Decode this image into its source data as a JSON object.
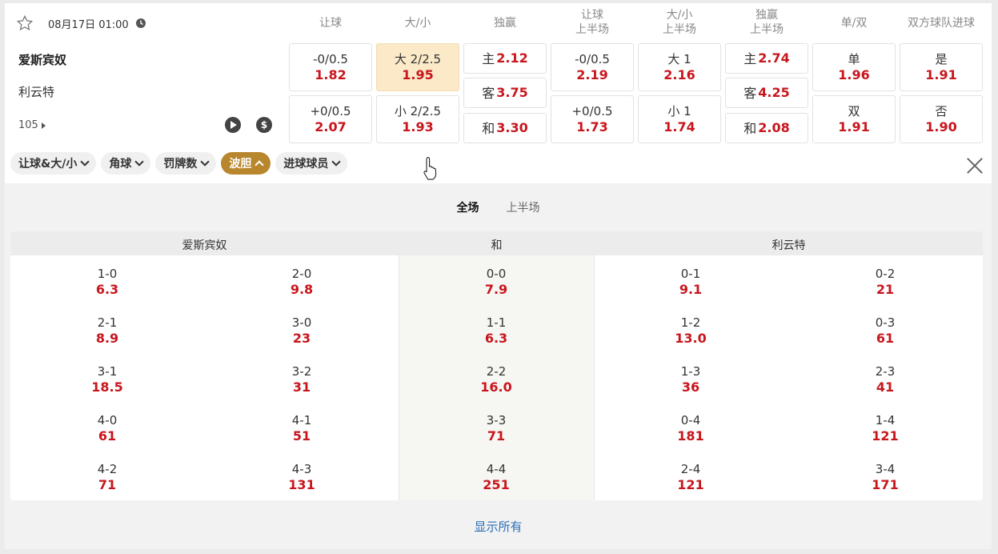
{
  "match": {
    "date": "08月17日 01:00",
    "home": "爱斯宾奴",
    "away": "利云特",
    "more_count": "105"
  },
  "columns": [
    {
      "line1": "让球",
      "line2": ""
    },
    {
      "line1": "大/小",
      "line2": ""
    },
    {
      "line1": "独赢",
      "line2": ""
    },
    {
      "line1": "让球",
      "line2": "上半场"
    },
    {
      "line1": "大/小",
      "line2": "上半场"
    },
    {
      "line1": "独赢",
      "line2": "上半场"
    },
    {
      "line1": "单/双",
      "line2": ""
    },
    {
      "line1": "双方球队进球",
      "line2": ""
    }
  ],
  "markets": {
    "ah_ft": [
      {
        "label": "-0/0.5",
        "odd": "1.82"
      },
      {
        "label": "+0/0.5",
        "odd": "2.07"
      }
    ],
    "ou_ft": [
      {
        "label": "大 2/2.5",
        "odd": "1.95"
      },
      {
        "label": "小 2/2.5",
        "odd": "1.93"
      }
    ],
    "x12_ft": [
      {
        "label": "主",
        "odd": "2.12"
      },
      {
        "label": "客",
        "odd": "3.75"
      },
      {
        "label": "和",
        "odd": "3.30"
      }
    ],
    "ah_ht": [
      {
        "label": "-0/0.5",
        "odd": "2.19"
      },
      {
        "label": "+0/0.5",
        "odd": "1.73"
      }
    ],
    "ou_ht": [
      {
        "label": "大 1",
        "odd": "2.16"
      },
      {
        "label": "小 1",
        "odd": "1.74"
      }
    ],
    "x12_ht": [
      {
        "label": "主",
        "odd": "2.74"
      },
      {
        "label": "客",
        "odd": "4.25"
      },
      {
        "label": "和",
        "odd": "2.08"
      }
    ],
    "oe": [
      {
        "label": "单",
        "odd": "1.96"
      },
      {
        "label": "双",
        "odd": "1.91"
      }
    ],
    "btts": [
      {
        "label": "是",
        "odd": "1.91"
      },
      {
        "label": "否",
        "odd": "1.90"
      }
    ]
  },
  "chips": [
    "让球&大/小",
    "角球",
    "罚牌数",
    "波胆",
    "进球球员"
  ],
  "period_tabs": [
    "全场",
    "上半场"
  ],
  "correct_score": {
    "headers": {
      "home": "爱斯宾奴",
      "draw": "和",
      "away": "利云特"
    },
    "home_a": [
      [
        "1-0",
        "6.3"
      ],
      [
        "2-1",
        "8.9"
      ],
      [
        "3-1",
        "18.5"
      ],
      [
        "4-0",
        "61"
      ],
      [
        "4-2",
        "71"
      ]
    ],
    "home_b": [
      [
        "2-0",
        "9.8"
      ],
      [
        "3-0",
        "23"
      ],
      [
        "3-2",
        "31"
      ],
      [
        "4-1",
        "51"
      ],
      [
        "4-3",
        "131"
      ]
    ],
    "draw": [
      [
        "0-0",
        "7.9"
      ],
      [
        "1-1",
        "6.3"
      ],
      [
        "2-2",
        "16.0"
      ],
      [
        "3-3",
        "71"
      ],
      [
        "4-4",
        "251"
      ]
    ],
    "away_a": [
      [
        "0-1",
        "9.1"
      ],
      [
        "1-2",
        "13.0"
      ],
      [
        "1-3",
        "36"
      ],
      [
        "0-4",
        "181"
      ],
      [
        "2-4",
        "121"
      ]
    ],
    "away_b": [
      [
        "0-2",
        "21"
      ],
      [
        "0-3",
        "61"
      ],
      [
        "2-3",
        "41"
      ],
      [
        "1-4",
        "121"
      ],
      [
        "3-4",
        "171"
      ]
    ]
  },
  "show_all": "显示所有",
  "colors": {
    "odds_red": "#c8161d",
    "active_chip": "#b8862d",
    "active_cell": "#fbe9c8",
    "link_blue": "#2a6fb5"
  }
}
